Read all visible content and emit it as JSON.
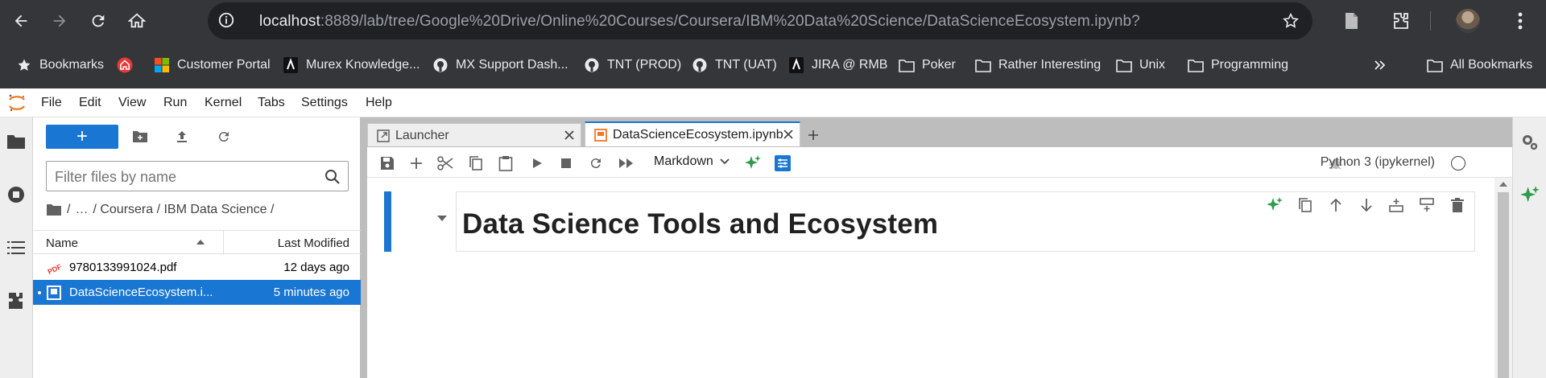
{
  "browser": {
    "url_host": "localhost",
    "url_rest": ":8889/lab/tree/Google%20Drive/Online%20Courses/Coursera/IBM%20Data%20Science/DataScienceEcosystem.ipynb?"
  },
  "bookmarks": [
    {
      "label": "Bookmarks",
      "icon": "star-icon"
    },
    {
      "label": "",
      "icon": "home-badge-icon"
    },
    {
      "label": "Customer Portal",
      "icon": "microsoft-icon"
    },
    {
      "label": "Murex Knowledge...",
      "icon": "murex-icon"
    },
    {
      "label": "MX Support Dash...",
      "icon": "github-icon"
    },
    {
      "label": "TNT (PROD)",
      "icon": "github-icon"
    },
    {
      "label": "TNT (UAT)",
      "icon": "github-icon"
    },
    {
      "label": "JIRA @ RMB",
      "icon": "murex-icon"
    },
    {
      "label": "Poker",
      "icon": "folder-icon"
    },
    {
      "label": "Rather Interesting",
      "icon": "folder-icon"
    },
    {
      "label": "Unix",
      "icon": "folder-icon"
    },
    {
      "label": "Programming",
      "icon": "folder-icon"
    },
    {
      "label": "All Bookmarks",
      "icon": "folder-icon"
    }
  ],
  "menu": [
    "File",
    "Edit",
    "View",
    "Run",
    "Kernel",
    "Tabs",
    "Settings",
    "Help"
  ],
  "filebrowser": {
    "new_label": "+",
    "filter_placeholder": "Filter files by name",
    "crumbs": [
      "/",
      "…",
      "/ Coursera / IBM Data Science /"
    ],
    "col_name": "Name",
    "col_modified": "Last Modified",
    "files": [
      {
        "name": "9780133991024.pdf",
        "modified": "12 days ago",
        "type": "pdf"
      },
      {
        "name": "DataScienceEcosystem.i...",
        "modified": "5 minutes ago",
        "type": "notebook"
      }
    ]
  },
  "tabs": [
    {
      "label": "Launcher"
    },
    {
      "label": "DataScienceEcosystem.ipynb"
    }
  ],
  "notebook": {
    "cell_type": "Markdown",
    "kernel": "Python 3 (ipykernel)",
    "heading": "Data Science Tools and Ecosystem"
  },
  "colors": {
    "accent": "#1976d2",
    "chrome": "#35363a",
    "ai_green": "#2e9b4e"
  }
}
